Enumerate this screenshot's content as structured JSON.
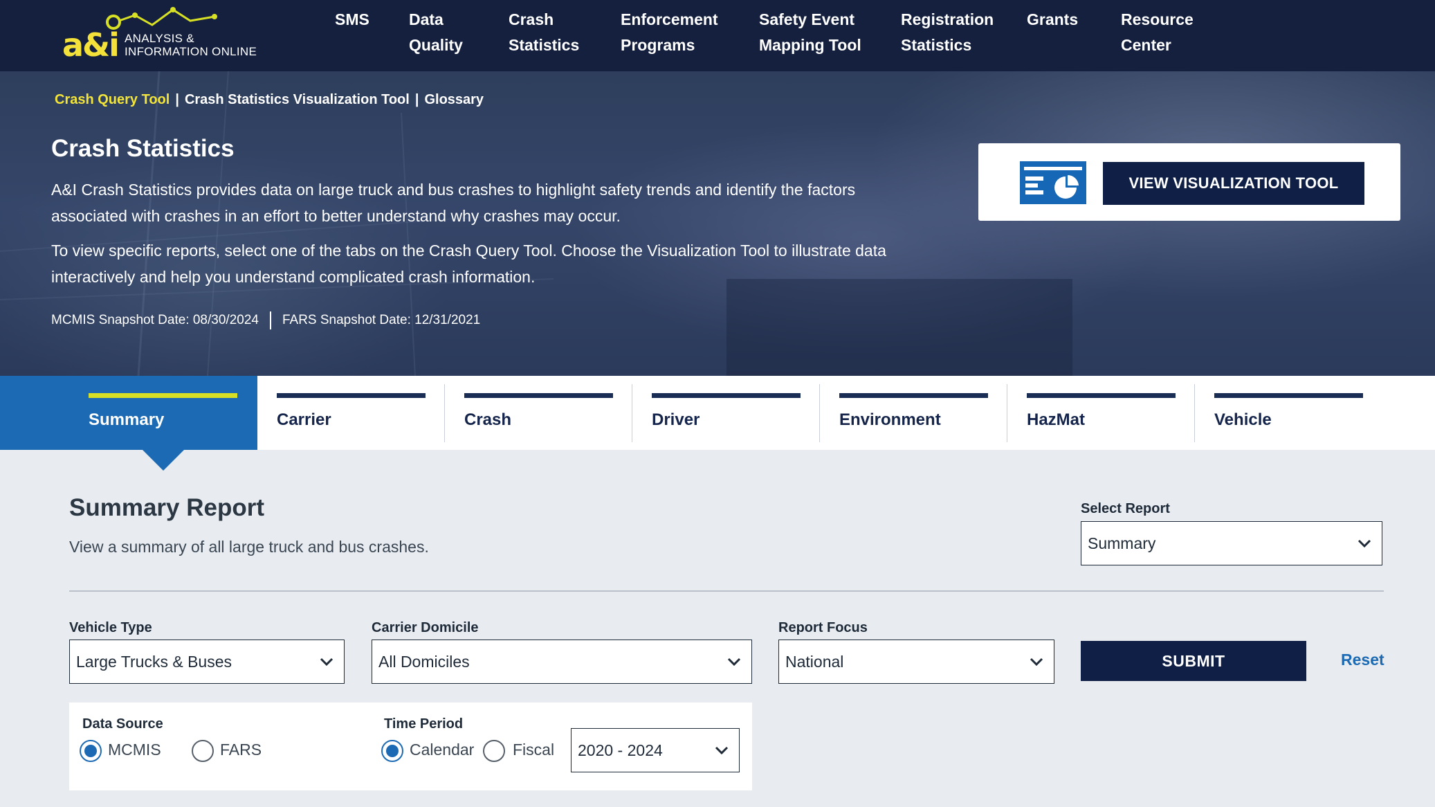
{
  "brand": {
    "logo_mark": "a&i",
    "logo_line1": "ANALYSIS &",
    "logo_line2": "INFORMATION ONLINE",
    "accent": "#d7e024",
    "navy": "#14203d",
    "blue": "#1c6ab3"
  },
  "nav": {
    "items": [
      {
        "line1": "SMS",
        "line2": ""
      },
      {
        "line1": "Data",
        "line2": "Quality"
      },
      {
        "line1": "Crash",
        "line2": "Statistics"
      },
      {
        "line1": "Enforcement",
        "line2": "Programs"
      },
      {
        "line1": "Safety Event",
        "line2": "Mapping Tool"
      },
      {
        "line1": "Registration",
        "line2": "Statistics"
      },
      {
        "line1": "Grants",
        "line2": ""
      },
      {
        "line1": "Resource",
        "line2": "Center"
      }
    ],
    "active_index": 2
  },
  "breadcrumb": {
    "items": [
      "Crash Query Tool",
      "Crash Statistics Visualization Tool",
      "Glossary"
    ],
    "separator": "|"
  },
  "hero": {
    "title": "Crash Statistics",
    "paragraph1": "A&I Crash Statistics provides data on large truck and bus crashes to highlight safety trends and identify the factors associated with crashes in an effort to better understand why crashes may occur.",
    "paragraph2": "To view specific reports, select one of the tabs on the Crash Query Tool. Choose the Visualization Tool to illustrate data interactively and help you understand complicated crash information.",
    "mcmis_snapshot": "MCMIS Snapshot Date: 08/30/2024",
    "fars_snapshot": "FARS Snapshot Date: 12/31/2021",
    "viz_button": "VIEW VISUALIZATION TOOL",
    "viz_icon": "chart-dashboard-icon"
  },
  "tabs": {
    "items": [
      "Summary",
      "Carrier",
      "Crash",
      "Driver",
      "Environment",
      "HazMat",
      "Vehicle"
    ],
    "active_index": 0
  },
  "report": {
    "title": "Summary Report",
    "description": "View a summary of all large truck and bus crashes.",
    "select_report_label": "Select Report",
    "select_report_value": "Summary"
  },
  "filters": {
    "vehicle_type_label": "Vehicle Type",
    "vehicle_type_value": "Large Trucks & Buses",
    "carrier_domicile_label": "Carrier Domicile",
    "carrier_domicile_value": "All Domiciles",
    "report_focus_label": "Report Focus",
    "report_focus_value": "National",
    "submit_label": "SUBMIT",
    "reset_label": "Reset"
  },
  "options": {
    "data_source_label": "Data Source",
    "data_source_options": [
      "MCMIS",
      "FARS"
    ],
    "data_source_selected": "MCMIS",
    "time_period_label": "Time Period",
    "time_period_options": [
      "Calendar",
      "Fiscal"
    ],
    "time_period_selected": "Calendar",
    "year_range_value": "2020 - 2024"
  }
}
